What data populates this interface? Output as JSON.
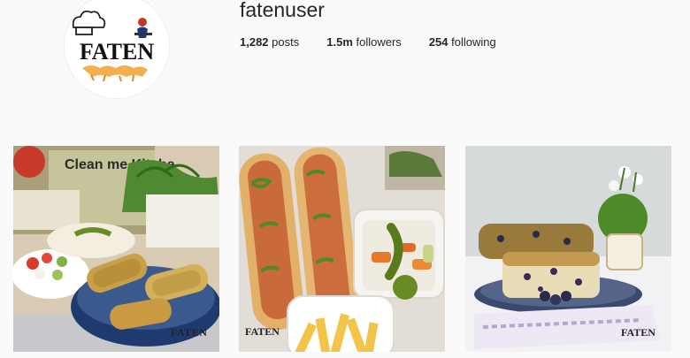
{
  "profile": {
    "avatar_logo_text": "FATEN",
    "username": "fatenuser"
  },
  "stats": {
    "posts_count": "1,282",
    "posts_label": "posts",
    "followers_count": "1.5m",
    "followers_label": "followers",
    "following_count": "254",
    "following_label": "following"
  },
  "posts": [
    {
      "image": "stuffed-zucchini-with-salad",
      "sign_text": "Clean me Kitche",
      "watermark": "FATEN"
    },
    {
      "image": "sandwich-rolls-with-pickles-and-fries",
      "watermark": "FATEN"
    },
    {
      "image": "blueberry-cake-with-flowers",
      "watermark": "FATEN"
    }
  ]
}
